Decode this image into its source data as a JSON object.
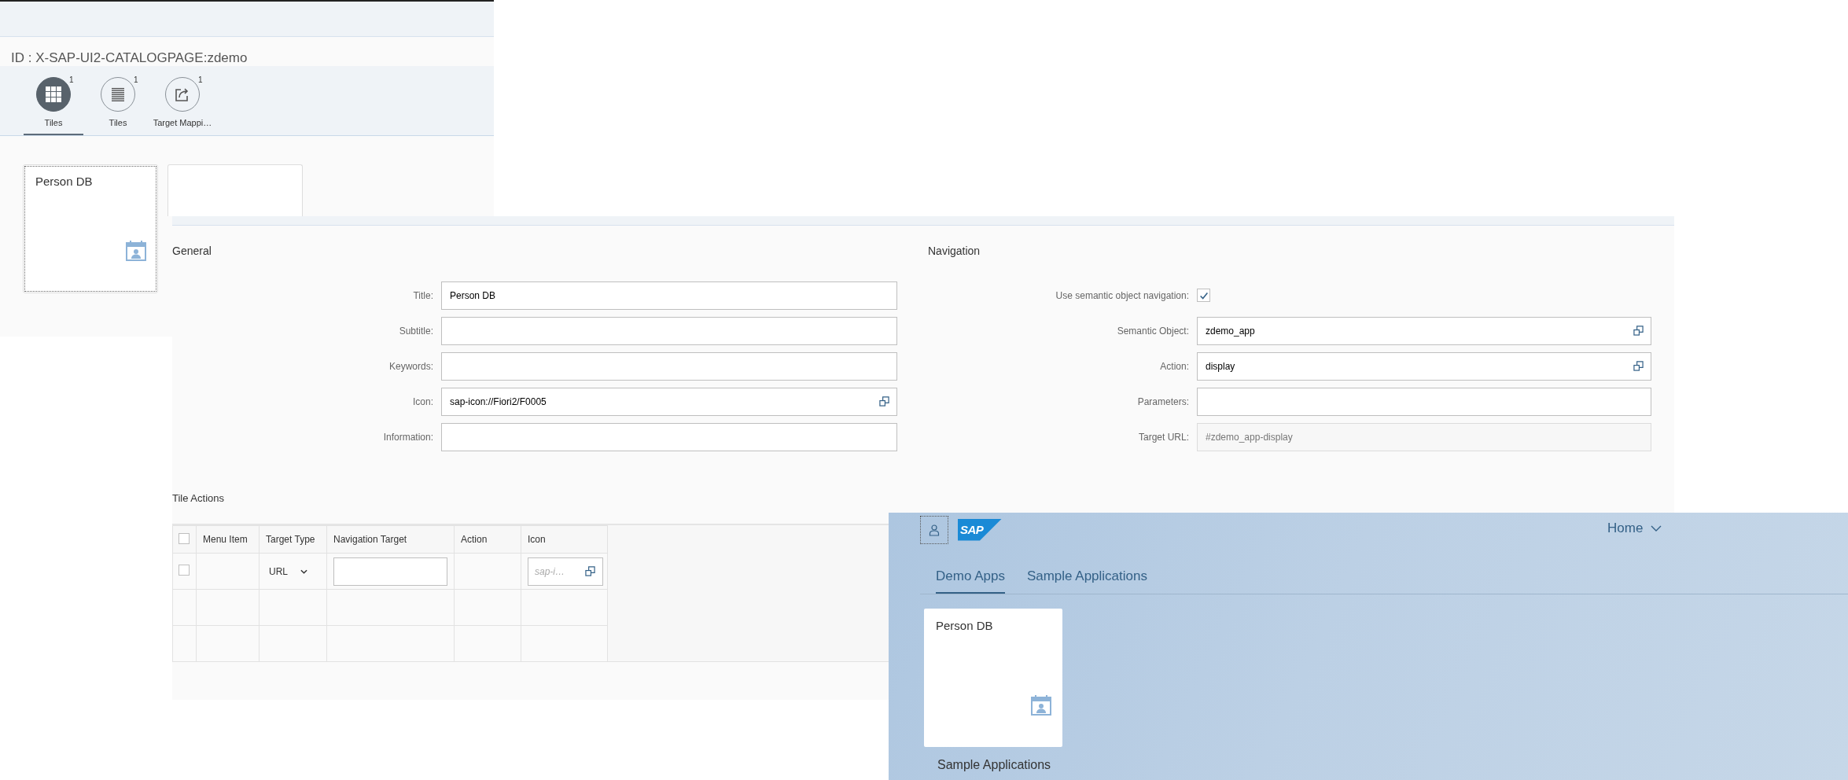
{
  "catalog_window": {
    "id_title": "ID : X-SAP-UI2-CATALOGPAGE:zdemo",
    "tabs": [
      {
        "kind": "grid",
        "label": "Tiles",
        "count": "1",
        "selected": true
      },
      {
        "kind": "list",
        "label": "Tiles",
        "count": "1",
        "selected": false
      },
      {
        "kind": "share",
        "label": "Target Mappi…",
        "count": "1",
        "selected": false
      }
    ],
    "tiles": [
      {
        "kind": "app",
        "title": "Person DB"
      },
      {
        "kind": "blank"
      }
    ]
  },
  "tile_editor": {
    "general": {
      "heading": "General",
      "fields": [
        {
          "label": "Title:",
          "value": "Person DB",
          "value_help": false,
          "disabled": false
        },
        {
          "label": "Subtitle:",
          "value_help": false,
          "disabled": false
        },
        {
          "label": "Keywords:",
          "value_help": false,
          "disabled": false
        },
        {
          "label": "Icon:",
          "value": "sap-icon://Fiori2/F0005",
          "value_help": true,
          "disabled": false
        },
        {
          "label": "Information:",
          "value_help": false,
          "disabled": false
        }
      ]
    },
    "navigation": {
      "heading": "Navigation",
      "semantic_navigation": {
        "label": "Use semantic object navigation:",
        "checked": true
      },
      "fields": [
        {
          "label": "Semantic Object:",
          "value": "zdemo_app",
          "value_help": true,
          "disabled": false
        },
        {
          "label": "Action:",
          "value": "display",
          "value_help": true,
          "disabled": false
        },
        {
          "label": "Parameters:",
          "value_help": false,
          "disabled": false
        },
        {
          "label": "Target URL:",
          "value": "#zdemo_app-display",
          "value_help": false,
          "disabled": true
        }
      ]
    },
    "tile_actions": {
      "heading": "Tile Actions",
      "header_checked": false,
      "columns": [
        "Menu Item",
        "Target Type",
        "Navigation Target",
        "Action",
        "Icon"
      ],
      "rows": [
        {
          "kind": "entry",
          "checked": false,
          "target_type": "URL",
          "icon_placeholder": "sap-i…"
        },
        {
          "kind": "empty"
        },
        {
          "kind": "empty"
        }
      ]
    }
  },
  "launchpad": {
    "logo_text": "SAP",
    "home_title": "Home",
    "tabs": [
      {
        "label": "Demo Apps",
        "selected": true
      },
      {
        "label": "Sample Applications",
        "selected": false
      }
    ],
    "tiles": [
      {
        "title": "Person DB"
      }
    ],
    "section_heading": "Sample Applications"
  }
}
